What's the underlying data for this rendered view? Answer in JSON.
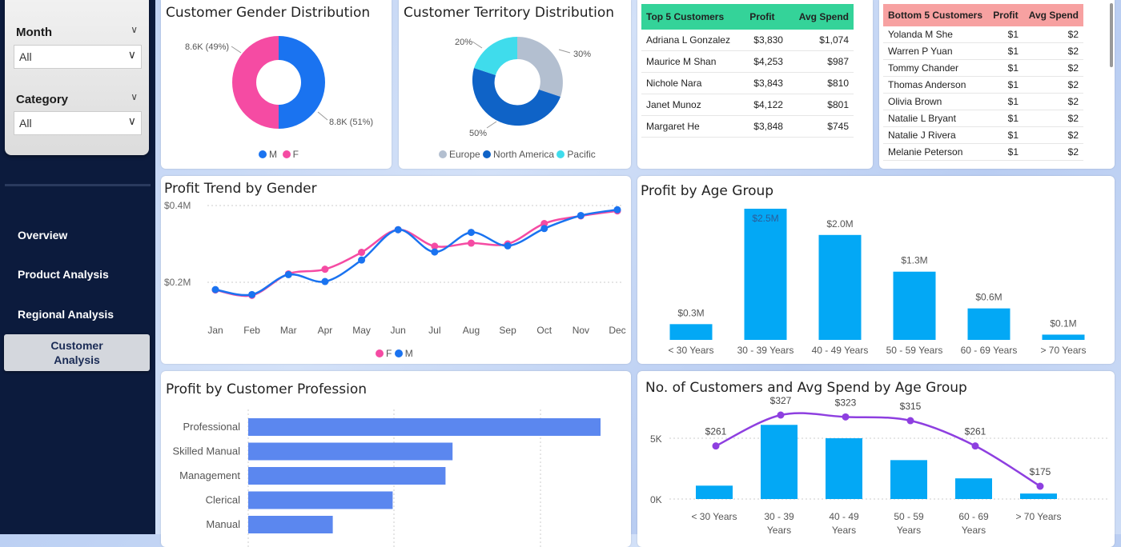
{
  "filters": {
    "month": {
      "label": "Month",
      "value": "All"
    },
    "category": {
      "label": "Category",
      "value": "All"
    }
  },
  "nav": {
    "items": [
      "Overview",
      "Product Analysis",
      "Regional Analysis"
    ],
    "active_line1": "Customer",
    "active_line2": "Analysis"
  },
  "gender_card": {
    "title": "Customer Gender Distribution",
    "label_f": "8.6K (49%)",
    "label_m": "8.8K (51%)",
    "legend_m": "M",
    "legend_f": "F",
    "colors": {
      "M": "#1a73f0",
      "F": "#f54ba3"
    }
  },
  "territory_card": {
    "title": "Customer Territory Distribution",
    "label_pacific": "20%",
    "label_europe": "30%",
    "label_na": "50%",
    "legend": [
      "Europe",
      "North America",
      "Pacific"
    ],
    "colors": {
      "Europe": "#b3bfd0",
      "North America": "#0f63c7",
      "Pacific": "#3fdcec"
    }
  },
  "top5": {
    "headers": [
      "Top 5 Customers",
      "Profit",
      "Avg Spend"
    ],
    "rows": [
      [
        "Adriana L Gonzalez",
        "$3,830",
        "$1,074"
      ],
      [
        "Maurice M Shan",
        "$4,253",
        "$987"
      ],
      [
        "Nichole Nara",
        "$3,843",
        "$810"
      ],
      [
        "Janet Munoz",
        "$4,122",
        "$801"
      ],
      [
        "Margaret He",
        "$3,848",
        "$745"
      ]
    ]
  },
  "bottom5": {
    "headers": [
      "Bottom 5 Customers",
      "Profit",
      "Avg Spend"
    ],
    "rows": [
      [
        "Yolanda M She",
        "$1",
        "$2"
      ],
      [
        "Warren P Yuan",
        "$1",
        "$2"
      ],
      [
        "Tommy Chander",
        "$1",
        "$2"
      ],
      [
        "Thomas Anderson",
        "$1",
        "$2"
      ],
      [
        "Olivia Brown",
        "$1",
        "$2"
      ],
      [
        "Natalie L Bryant",
        "$1",
        "$2"
      ],
      [
        "Natalie J Rivera",
        "$1",
        "$2"
      ],
      [
        "Melanie Peterson",
        "$1",
        "$2"
      ]
    ]
  },
  "trend_card": {
    "title": "Profit Trend by Gender",
    "legend_f": "F",
    "legend_m": "M"
  },
  "age_card": {
    "title": "Profit by Age Group"
  },
  "profession_card": {
    "title": "Profit by Customer Profession"
  },
  "combo_card": {
    "title": "No. of Customers and Avg Spend by Age Group"
  },
  "chart_data": [
    {
      "type": "line",
      "x": [
        "Jan",
        "Feb",
        "Mar",
        "Apr",
        "May",
        "Jun",
        "Jul",
        "Aug",
        "Sep",
        "Oct",
        "Nov",
        "Dec"
      ],
      "yticks": [
        "$0.2M",
        "$0.4M"
      ],
      "ylim": [
        0.15,
        0.42
      ],
      "series": [
        {
          "name": "F",
          "color": "#f54ba3",
          "values": [
            0.18,
            0.166,
            0.222,
            0.234,
            0.278,
            0.337,
            0.294,
            0.302,
            0.3,
            0.353,
            0.373,
            0.386
          ]
        },
        {
          "name": "M",
          "color": "#1a73f0",
          "values": [
            0.181,
            0.168,
            0.22,
            0.202,
            0.258,
            0.337,
            0.279,
            0.33,
            0.295,
            0.34,
            0.374,
            0.389
          ]
        }
      ]
    },
    {
      "type": "bar",
      "categories": [
        "< 30 Years",
        "30 - 39 Years",
        "40 - 49 Years",
        "50 - 59 Years",
        "60 - 69 Years",
        "> 70 Years"
      ],
      "values": [
        0.3,
        2.5,
        2.0,
        1.3,
        0.6,
        0.1
      ],
      "labels": [
        "$0.3M",
        "$2.5M",
        "$2.0M",
        "$1.3M",
        "$0.6M",
        "$0.1M"
      ],
      "color": "#03a8f5"
    },
    {
      "type": "bar",
      "orientation": "horizontal",
      "categories": [
        "Professional",
        "Skilled Manual",
        "Management",
        "Clerical",
        "Manual"
      ],
      "values": [
        100,
        58,
        56,
        41,
        24
      ],
      "color": "#5b87ef"
    },
    {
      "type": "bar",
      "categories": [
        "< 30 Years",
        "30 - 39 Years",
        "40 - 49 Years",
        "50 - 59 Years",
        "60 - 69 Years",
        "> 70 Years"
      ],
      "category_lines": [
        [
          "< 30 Years"
        ],
        [
          "30 - 39",
          "Years"
        ],
        [
          "40 - 49",
          "Years"
        ],
        [
          "50 - 59",
          "Years"
        ],
        [
          "60 - 69",
          "Years"
        ],
        [
          "> 70 Years"
        ]
      ],
      "yticks": [
        "0K",
        "5K"
      ],
      "series": [
        {
          "name": "No. of Customers",
          "type": "bar",
          "color": "#03a8f5",
          "values": [
            1.1,
            6.1,
            5.0,
            3.2,
            1.7,
            0.45
          ]
        },
        {
          "name": "Avg Spend",
          "type": "line",
          "color": "#8e3fe0",
          "values": [
            261,
            327,
            323,
            315,
            261,
            175
          ],
          "labels": [
            "$261",
            "$327",
            "$323",
            "$315",
            "$261",
            "$175"
          ]
        }
      ]
    }
  ]
}
